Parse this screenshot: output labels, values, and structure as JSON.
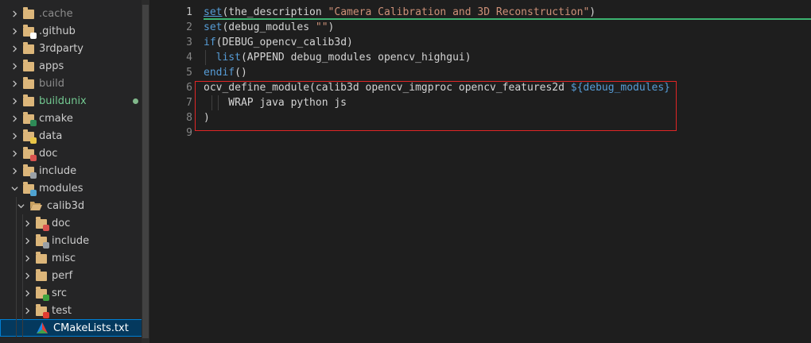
{
  "explorer": {
    "items": [
      {
        "name": "tree-folder-cache",
        "label": ".cache",
        "level": 0,
        "icon": "folder-icon",
        "expanded": false,
        "muted": true
      },
      {
        "name": "tree-folder-github",
        "label": ".github",
        "level": 0,
        "icon": "github-folder-icon",
        "expanded": false
      },
      {
        "name": "tree-folder-3rdparty",
        "label": "3rdparty",
        "level": 0,
        "icon": "folder-icon",
        "expanded": false
      },
      {
        "name": "tree-folder-apps",
        "label": "apps",
        "level": 0,
        "icon": "folder-icon",
        "expanded": false
      },
      {
        "name": "tree-folder-build",
        "label": "build",
        "level": 0,
        "icon": "folder-icon",
        "expanded": false,
        "muted": true
      },
      {
        "name": "tree-folder-buildunix",
        "label": "buildunix",
        "level": 0,
        "icon": "folder-icon",
        "expanded": false,
        "modified": true
      },
      {
        "name": "tree-folder-cmake",
        "label": "cmake",
        "level": 0,
        "icon": "cmake-folder-icon",
        "expanded": false
      },
      {
        "name": "tree-folder-data",
        "label": "data",
        "level": 0,
        "icon": "data-folder-icon",
        "expanded": false
      },
      {
        "name": "tree-folder-doc",
        "label": "doc",
        "level": 0,
        "icon": "doc-folder-icon",
        "expanded": false
      },
      {
        "name": "tree-folder-include",
        "label": "include",
        "level": 0,
        "icon": "include-folder-icon",
        "expanded": false
      },
      {
        "name": "tree-folder-modules",
        "label": "modules",
        "level": 0,
        "icon": "modules-folder-icon",
        "expanded": true
      },
      {
        "name": "tree-folder-calib3d",
        "label": "calib3d",
        "level": 1,
        "icon": "open-folder-icon",
        "expanded": true
      },
      {
        "name": "tree-folder-calib3d-doc",
        "label": "doc",
        "level": 2,
        "icon": "doc-folder-icon",
        "expanded": false
      },
      {
        "name": "tree-folder-calib3d-include",
        "label": "include",
        "level": 2,
        "icon": "include-folder-icon",
        "expanded": false
      },
      {
        "name": "tree-folder-misc",
        "label": "misc",
        "level": 2,
        "icon": "folder-icon",
        "expanded": false
      },
      {
        "name": "tree-folder-perf",
        "label": "perf",
        "level": 2,
        "icon": "folder-icon",
        "expanded": false
      },
      {
        "name": "tree-folder-src",
        "label": "src",
        "level": 2,
        "icon": "src-folder-icon",
        "expanded": false
      },
      {
        "name": "tree-folder-test",
        "label": "test",
        "level": 2,
        "icon": "test-folder-icon",
        "expanded": false
      },
      {
        "name": "tree-file-cmakelists",
        "label": "CMakeLists.txt",
        "level": 2,
        "icon": "cmake-file-icon",
        "file": true,
        "selected": true
      }
    ]
  },
  "editor": {
    "line_numbers": [
      "1",
      "2",
      "3",
      "4",
      "5",
      "6",
      "7",
      "8",
      "9"
    ],
    "active_line": 1,
    "lines": [
      [
        {
          "t": "set",
          "c": "kw"
        },
        {
          "t": "(the_description ",
          "c": "p"
        },
        {
          "t": "\"Camera Calibration and 3D Reconstruction\"",
          "c": "str"
        },
        {
          "t": ")",
          "c": "p"
        }
      ],
      [
        {
          "t": "set",
          "c": "kw2"
        },
        {
          "t": "(debug_modules ",
          "c": "p"
        },
        {
          "t": "\"\"",
          "c": "str"
        },
        {
          "t": ")",
          "c": "p"
        }
      ],
      [
        {
          "t": "if",
          "c": "kw2"
        },
        {
          "t": "(DEBUG_opencv_calib3d)",
          "c": "p"
        }
      ],
      [
        {
          "t": "  ",
          "c": "p"
        },
        {
          "t": "list",
          "c": "kw2"
        },
        {
          "t": "(APPEND debug_modules opencv_highgui)",
          "c": "p"
        }
      ],
      [
        {
          "t": "endif",
          "c": "kw2"
        },
        {
          "t": "()",
          "c": "p"
        }
      ],
      [
        {
          "t": "ocv_define_module(calib3d opencv_imgproc opencv_features2d ",
          "c": "p"
        },
        {
          "t": "${debug_modules}",
          "c": "var"
        }
      ],
      [
        {
          "t": "    WRAP java python js",
          "c": "p"
        }
      ],
      [
        {
          "t": ")",
          "c": "p"
        }
      ],
      []
    ]
  },
  "colors": {
    "accent": "#007fd4",
    "highlight_box": "#e02626",
    "cursor_line": "#3cb371",
    "modified_dot": "#81b88b"
  }
}
